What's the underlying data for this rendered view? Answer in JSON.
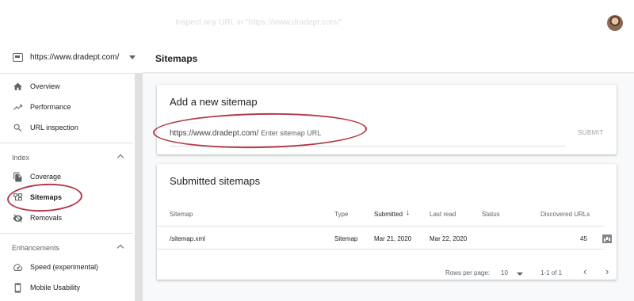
{
  "header": {
    "search_placeholder": "Inspect any URL in \"https://www.dradept.com/\""
  },
  "property": {
    "url": "https://www.dradept.com/"
  },
  "sidebar": {
    "items": [
      {
        "label": "Overview",
        "icon": "home-icon"
      },
      {
        "label": "Performance",
        "icon": "trending-up-icon"
      },
      {
        "label": "URL inspection",
        "icon": "search-icon"
      }
    ],
    "index_section": {
      "label": "Index",
      "items": [
        {
          "label": "Coverage",
          "icon": "copy-icon"
        },
        {
          "label": "Sitemaps",
          "icon": "sitemap-icon",
          "active": true
        },
        {
          "label": "Removals",
          "icon": "eye-off-icon"
        }
      ]
    },
    "enhancements_section": {
      "label": "Enhancements",
      "items": [
        {
          "label": "Speed (experimental)",
          "icon": "speedometer-icon"
        },
        {
          "label": "Mobile Usability",
          "icon": "phone-icon"
        }
      ]
    }
  },
  "main": {
    "title": "Sitemaps",
    "add_card": {
      "title": "Add a new sitemap",
      "prefix": "https://www.dradept.com/",
      "placeholder": "Enter sitemap URL",
      "submit_label": "SUBMIT"
    },
    "submitted_card": {
      "title": "Submitted sitemaps",
      "columns": [
        "Sitemap",
        "Type",
        "Submitted",
        "Last read",
        "Status",
        "Discovered URLs"
      ],
      "sort_arrow": "↓",
      "rows": [
        {
          "sitemap": "/sitemap.xml",
          "type": "Sitemap",
          "submitted": "Mar 21, 2020",
          "last_read": "Mar 22, 2020",
          "status": "",
          "discovered_urls": "45"
        }
      ],
      "pagination": {
        "rows_per_page_label": "Rows per page:",
        "rows_per_page_value": "10",
        "range": "1-1 of 1",
        "prev": "‹",
        "next": "›"
      }
    }
  },
  "colors": {
    "annotation": "#b23a48",
    "text_primary": "#202124",
    "text_secondary": "#5f6368",
    "background": "#f8f9fa"
  }
}
